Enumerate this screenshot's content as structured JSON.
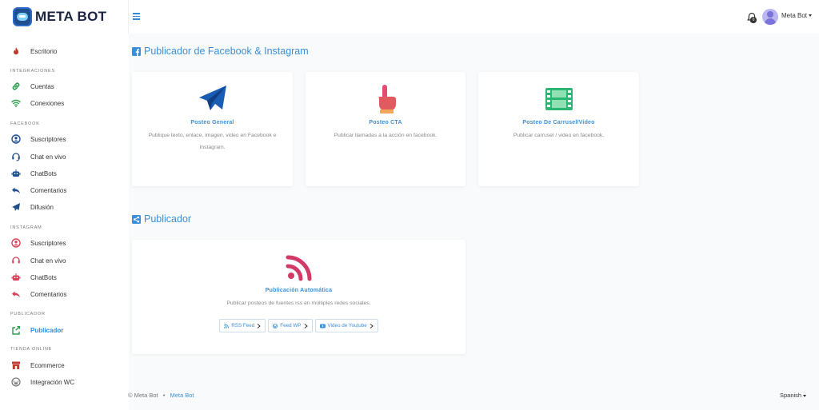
{
  "brand": {
    "name": "META BOT",
    "logo_icon": "robot-logo-icon"
  },
  "header": {
    "user_name": "Meta Bot",
    "notifications": "0"
  },
  "sidebar": {
    "sections": {
      "integraciones": "INTEGRACIONES",
      "facebook": "FACEBOOK",
      "instagram": "INSTAGRAM",
      "publicador": "PUBLICADOR",
      "tienda": "TIENDA ONLINE"
    },
    "items": {
      "escritorio": "Escritorio",
      "cuentas": "Cuentas",
      "conexiones": "Conexiones",
      "fb_suscriptores": "Suscriptores",
      "fb_chat": "Chat en vivo",
      "fb_chatbots": "ChatBots",
      "fb_comentarios": "Comentarios",
      "difusion": "Difusión",
      "ig_suscriptores": "Suscriptores",
      "ig_chat": "Chat en vivo",
      "ig_chatbots": "ChatBots",
      "ig_comentarios": "Comentarios",
      "publicador": "Publicador",
      "ecommerce": "Ecommerce",
      "integracion_wc": "Integración WC"
    }
  },
  "main": {
    "section1_title": "Publicador de Facebook & Instagram",
    "section2_title": "Publicador",
    "cards": {
      "general": {
        "title": "Posteo General",
        "desc": "Publique texto, enlace, imagen, video en Facebook e Instagram."
      },
      "cta": {
        "title": "Posteo CTA",
        "desc": "Publicar llamadas a la acción en facebook."
      },
      "carrusel": {
        "title": "Posteo De Carrusel/Video",
        "desc": "Publicar carrusel / video en facebook."
      },
      "auto": {
        "title": "Publicación Automática",
        "desc": "Publicar posteos de fuentes rss en múltiples redes sociales."
      }
    },
    "buttons": {
      "rss": "RSS Feed",
      "wp": "Feed WP",
      "youtube": "Video de Youtube"
    }
  },
  "footer": {
    "copyright": "© Meta Bot",
    "separator": "•",
    "link": "Meta Bot",
    "language": "Spanish"
  },
  "colors": {
    "accent": "#3b8fd9",
    "sidebar_icon_red": "#c0392b",
    "sidebar_icon_blue": "#1f4f8f"
  }
}
